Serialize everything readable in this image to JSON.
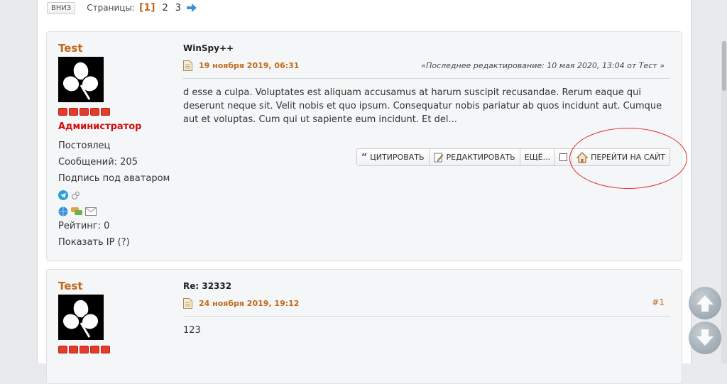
{
  "toolbar": {
    "down_label": "ВНИЗ",
    "pages_label": "Страницы:",
    "current_page": "[1]",
    "page_2": "2",
    "page_3": "3"
  },
  "posts": [
    {
      "author": "Test",
      "rank": "Администратор",
      "status": "Постоялец",
      "messages": "Сообщений: 205",
      "signature": "Подпись под аватаром",
      "rating": "Рейтинг: 0",
      "show_ip": "Показать IP (?)",
      "title": "WinSpy++",
      "date": "19 ноября 2019, 06:31",
      "edit_note": "«Последнее редактирование: 10 мая 2020, 13:04 от Тест »",
      "text": "d esse a culpa. Voluptates est aliquam accusamus at harum suscipit recusandae. Rerum eaque qui deserunt neque sit. Velit nobis et quo ipsum. Consequatur nobis pariatur ab quos incidunt aut. Cumque aut et voluptas. Cum qui ut sapiente eum incidunt. Et del...",
      "actions": {
        "quote": "ЦИТИРОВАТЬ",
        "edit": "РЕДАКТИРОВАТЬ",
        "more": "ЕЩЁ...",
        "goto": "ПЕРЕЙТИ НА САЙТ"
      }
    },
    {
      "author": "Test",
      "title": "Re: 32332",
      "date": "24 ноября 2019, 19:12",
      "number": "#1",
      "text": "123"
    }
  ],
  "colors": {
    "accent": "#c06a1c",
    "rank": "#d10e0e",
    "highlight": "#e0262a"
  },
  "icons": {
    "next": "arrow-right-icon",
    "doc": "document-icon",
    "telegram": "telegram-icon",
    "gender": "male-female-icon",
    "web": "globe-icon",
    "pm": "chat-icon",
    "mail": "envelope-icon",
    "home": "house-icon",
    "up": "scroll-up-icon",
    "down": "scroll-down-icon"
  }
}
